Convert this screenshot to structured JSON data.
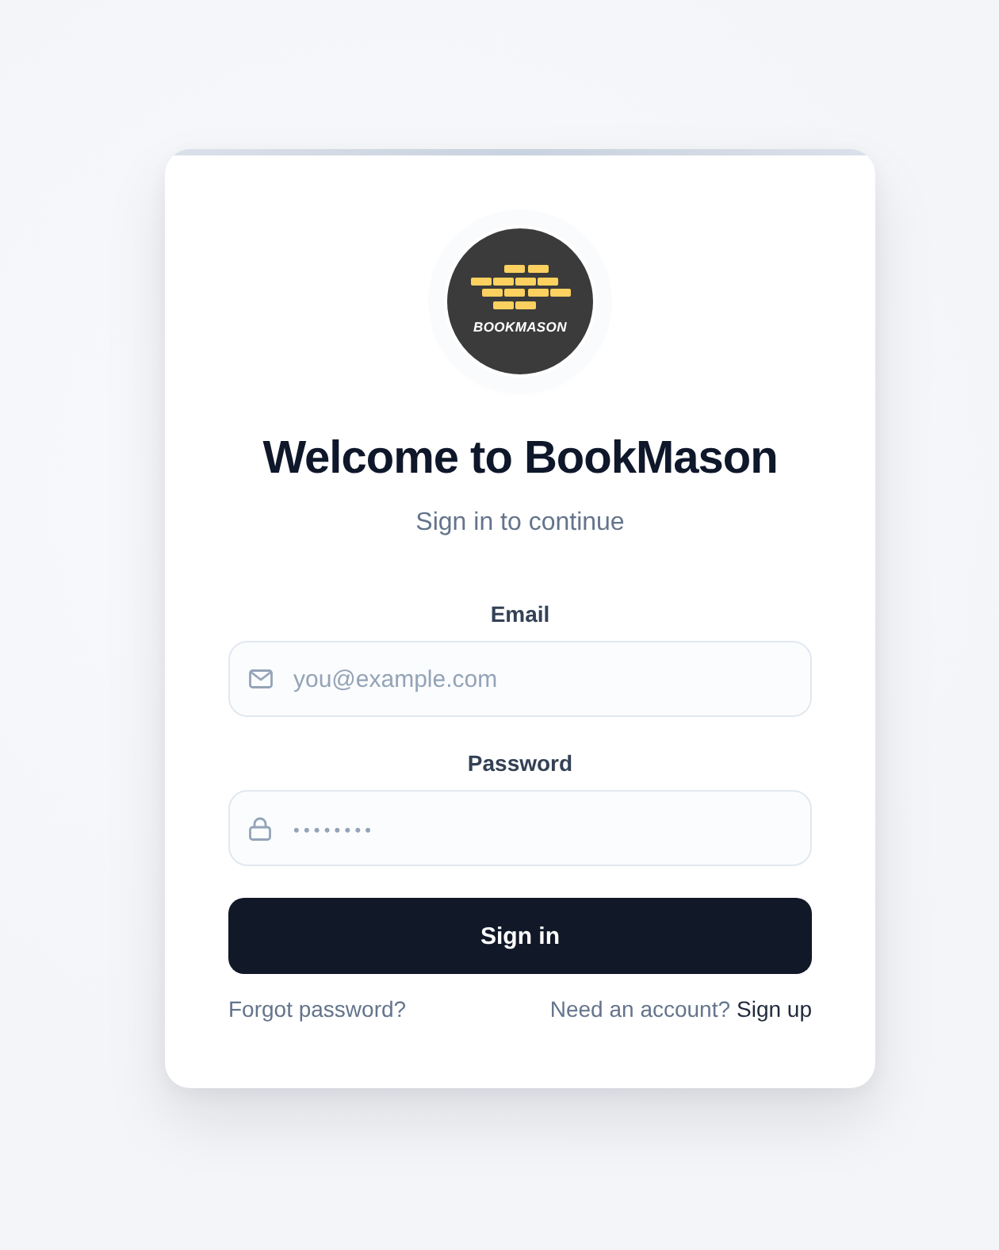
{
  "logo": {
    "wordmark": "BOOKMASON"
  },
  "heading": "Welcome to BookMason",
  "subtitle": "Sign in to continue",
  "fields": [
    {
      "kind": "email",
      "label": "Email",
      "placeholder": "you@example.com"
    },
    {
      "kind": "password",
      "label": "Password",
      "placeholder": "••••••••"
    }
  ],
  "submit": "Sign in",
  "links": {
    "forgot": "Forgot password?",
    "prompt": "Need an account?",
    "signup": "Sign up"
  }
}
